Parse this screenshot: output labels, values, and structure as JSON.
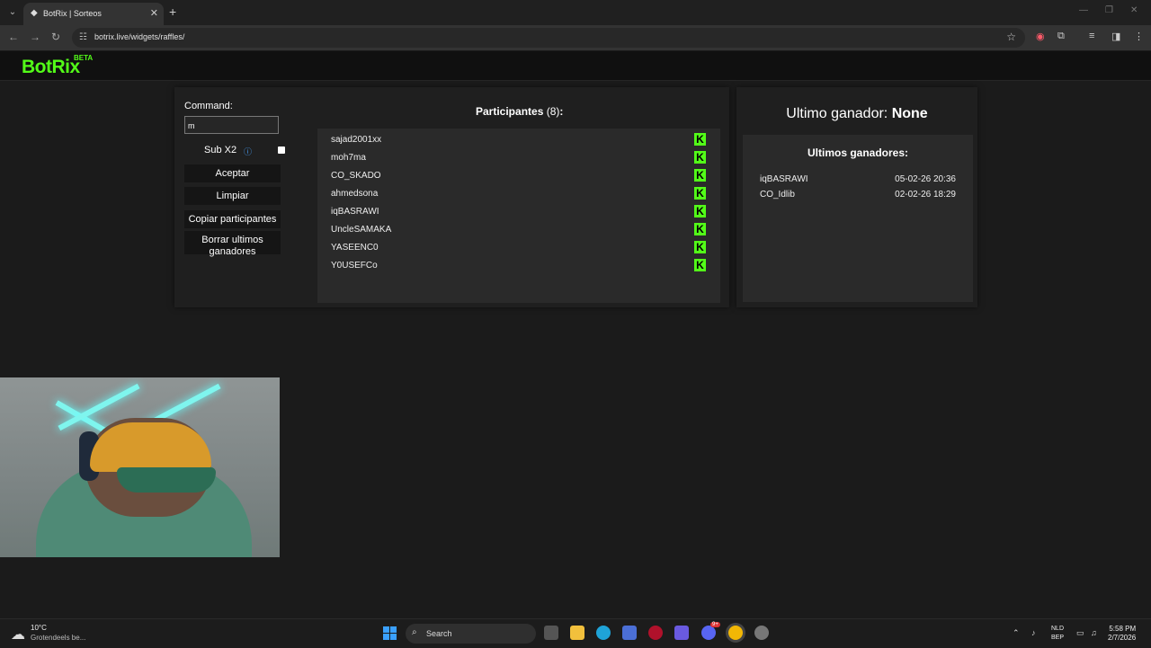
{
  "browser": {
    "tab_title": "BotRix | Sorteos",
    "url": "botrix.live/widgets/raffles/"
  },
  "app": {
    "logo": "BotRix",
    "beta": "BETA",
    "brand_color": "#53fc18"
  },
  "controls": {
    "command_label": "Command:",
    "command_value": "m",
    "subx2_label": "Sub X2",
    "accept": "Aceptar",
    "clear": "Limpiar",
    "copy": "Copiar participantes",
    "delete_line1": "Borrar ultimos",
    "delete_line2": "ganadores"
  },
  "participants": {
    "title": "Participantes",
    "count": "(8)",
    "colon": ":",
    "names": [
      "sajad2001xx",
      "moh7ma",
      "CO_SKADO",
      "ahmedsona",
      "iqBASRAWI",
      "UncleSAMAKA",
      "YASEENC0",
      "Y0USEFCo"
    ]
  },
  "winners": {
    "last_label": "Ultimo ganador:",
    "last_value": "None",
    "list_title": "Ultimos ganadores:",
    "list": [
      {
        "name": "iqBASRAWI",
        "date": "05-02-26 20:36"
      },
      {
        "name": "CO_Idlib",
        "date": "02-02-26 18:29"
      }
    ]
  },
  "taskbar": {
    "temp": "10°C",
    "weather": "Grotendeels be...",
    "search": "Search",
    "lang1": "NLD",
    "lang2": "BEP",
    "time": "5:58 PM",
    "date": "2/7/2026",
    "discord_badge": "9+"
  }
}
